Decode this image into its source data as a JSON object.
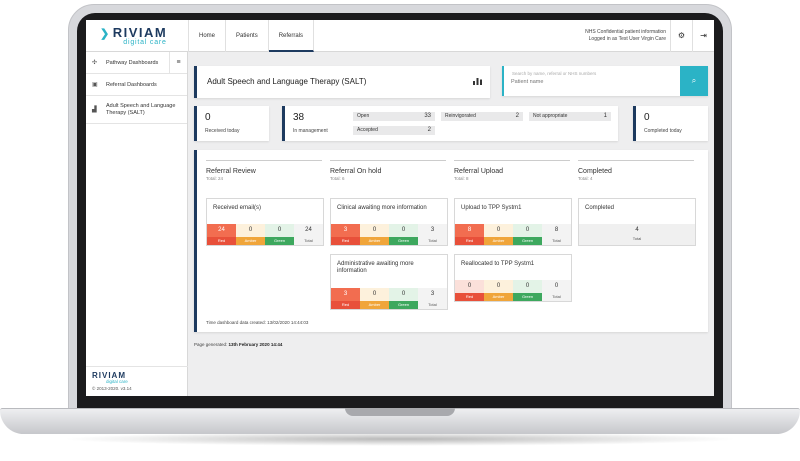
{
  "header": {
    "logo_text": "RIVIAM",
    "logo_sub": "digital care",
    "nav": [
      {
        "label": "Home"
      },
      {
        "label": "Patients"
      },
      {
        "label": "Referrals"
      }
    ],
    "info_line1": "NHS Confidential patient information",
    "info_line2": "Logged in as Test User Virgin Care",
    "settings_icon": "gear-icon",
    "logout_icon": "logout-icon"
  },
  "sidebar": {
    "items": [
      {
        "label": "Pathway Dashboards",
        "icon": "pathway-icon"
      },
      {
        "label": "Referral Dashboards",
        "icon": "briefcase-icon"
      },
      {
        "label": "Adult Speech and Language Therapy (SALT)",
        "icon": "chart-icon"
      }
    ],
    "toggle_icon": "menu-icon",
    "footer_logo": "RIVIAM",
    "footer_sub": "digital care",
    "footer_version": "© 2013-2020. v3.14"
  },
  "main": {
    "title": "Adult Speech and Language Therapy (SALT)",
    "search": {
      "placeholder_label": "Search by name, referral or NHS numbers",
      "placeholder": "Patient name"
    },
    "stats": {
      "received": {
        "value": "0",
        "label": "Received today"
      },
      "in_management": {
        "value": "38",
        "label": "In management"
      },
      "open": {
        "label": "Open",
        "value": "33"
      },
      "accepted": {
        "label": "Accepted",
        "value": "2"
      },
      "reinvigorated": {
        "label": "Reinvigorated",
        "value": "2"
      },
      "not_appropriate": {
        "label": "Not appropriate",
        "value": "1"
      },
      "completed": {
        "value": "0",
        "label": "Completed today"
      }
    },
    "columns": [
      {
        "title": "Referral Review",
        "subtitle": "Total: 24"
      },
      {
        "title": "Referral On hold",
        "subtitle": "Total: 6"
      },
      {
        "title": "Referral Upload",
        "subtitle": "Total: 8"
      },
      {
        "title": "Completed",
        "subtitle": "Total: 4"
      }
    ],
    "cell_labels": {
      "red": "Red",
      "amber": "Amber",
      "green": "Green",
      "total": "Total"
    },
    "cards": {
      "received_emails": {
        "title": "Received email(s)",
        "red": "24",
        "amber": "0",
        "green": "0",
        "total": "24"
      },
      "clinical": {
        "title": "Clinical awaiting more information",
        "red": "3",
        "amber": "0",
        "green": "0",
        "total": "3"
      },
      "administrative": {
        "title": "Administrative awaiting more information",
        "red": "3",
        "amber": "0",
        "green": "0",
        "total": "3"
      },
      "upload_tpp": {
        "title": "Upload to TPP Systm1",
        "red": "8",
        "amber": "0",
        "green": "0",
        "total": "8"
      },
      "reallocated_tpp": {
        "title": "Reallocated to TPP Systm1",
        "red": "0",
        "amber": "0",
        "green": "0",
        "total": "0"
      },
      "completed": {
        "title": "Completed",
        "total": "4",
        "total_label": "Total"
      }
    },
    "footnote": "Time dashboard data created: 13/02/2020 14:44:03",
    "generated_label": "Page generated:",
    "generated_value": "13th February 2020 14:44"
  }
}
